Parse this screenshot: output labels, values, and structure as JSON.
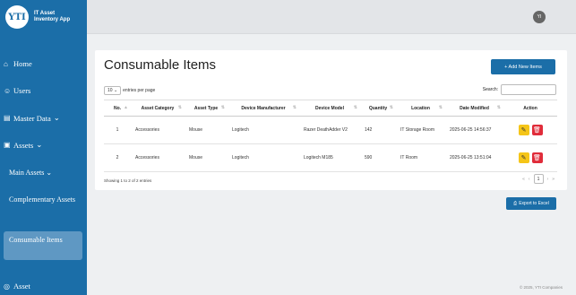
{
  "brand": {
    "logo": "YTI",
    "line1": "IT Asset",
    "line2": "Inventory App"
  },
  "user": {
    "initials": "YI"
  },
  "sidebar": {
    "home": "Home",
    "users": "Users",
    "master_data": "Master Data",
    "assets": "Assets",
    "main_assets": "Main Assets",
    "complementary_assets": "Complementary Assets",
    "consumable_items": "Consumable Items",
    "asset_partial": "Asset"
  },
  "page": {
    "title": "Consumable Items",
    "add_button": "+ Add New Items",
    "entries_value": "10",
    "entries_label": "entries per page",
    "search_label": "Search:",
    "showing": "Showing 1 to 2 of 2 entries",
    "page_number": "1",
    "export_button": "Export to Excel"
  },
  "table": {
    "headers": [
      "No.",
      "Asset Category",
      "Asset Type",
      "Device Manufacturer",
      "Device Model",
      "Quantity",
      "Location",
      "Date Modified",
      "Action"
    ],
    "rows": [
      {
        "no": "1",
        "category": "Accessories",
        "type": "Mouse",
        "manufacturer": "Logitech",
        "model": "Razer DeathAdder V2",
        "quantity": "142",
        "location": "IT Storage Room",
        "date": "2025-06-25 14:56:37"
      },
      {
        "no": "2",
        "category": "Accessories",
        "type": "Mouse",
        "manufacturer": "Logitech",
        "model": "Logitech M185",
        "quantity": "590",
        "location": "IT Room",
        "date": "2025-06-25 13:51:04"
      }
    ]
  },
  "footer": "© 2025, YTI Companies"
}
